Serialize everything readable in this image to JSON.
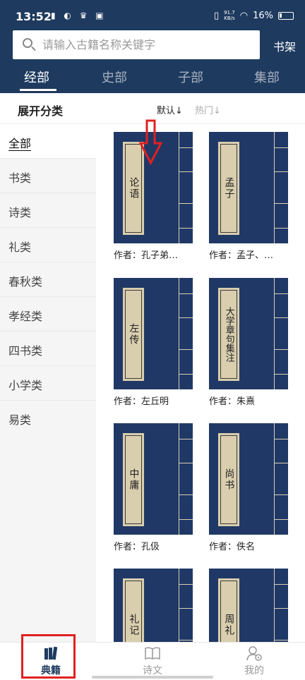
{
  "status_bar": {
    "time": "13:52",
    "left_icons": "▮ ◐ ♛ ▣",
    "net_speed_value": "91.7",
    "net_speed_unit": "KB/s",
    "battery": "16%"
  },
  "search": {
    "placeholder": "请输入古籍名称关键字",
    "shelf_label": "书架"
  },
  "categories": [
    {
      "label": "经部",
      "active": true
    },
    {
      "label": "史部",
      "active": false
    },
    {
      "label": "子部",
      "active": false
    },
    {
      "label": "集部",
      "active": false
    }
  ],
  "subheader": {
    "expand_label": "展开分类",
    "sort_default": "默认↓",
    "sort_hot": "热门↓"
  },
  "sidebar": {
    "items": [
      {
        "label": "全部",
        "active": true
      },
      {
        "label": "书类",
        "active": false
      },
      {
        "label": "诗类",
        "active": false
      },
      {
        "label": "礼类",
        "active": false
      },
      {
        "label": "春秋类",
        "active": false
      },
      {
        "label": "孝经类",
        "active": false
      },
      {
        "label": "四书类",
        "active": false
      },
      {
        "label": "小学类",
        "active": false
      },
      {
        "label": "易类",
        "active": false
      }
    ]
  },
  "books": [
    {
      "title": "论语",
      "author": "作者：孔子弟…"
    },
    {
      "title": "孟子",
      "author": "作者：孟子、…"
    },
    {
      "title": "左传",
      "author": "作者：左丘明"
    },
    {
      "title": "大学章句集注",
      "author": "作者：朱熹"
    },
    {
      "title": "中庸",
      "author": "作者：孔伋"
    },
    {
      "title": "尚书",
      "author": "作者：佚名"
    },
    {
      "title": "礼记",
      "author": ""
    },
    {
      "title": "周礼",
      "author": ""
    }
  ],
  "bottom_nav": [
    {
      "label": "典籍",
      "icon": "books-icon",
      "active": true
    },
    {
      "label": "诗文",
      "icon": "open-book-icon",
      "active": false
    },
    {
      "label": "我的",
      "icon": "user-settings-icon",
      "active": false
    }
  ],
  "colors": {
    "primary": "#1e3a5f",
    "cover": "#1f3866",
    "label_paper": "#d9ceae",
    "annotation_red": "#e02020"
  }
}
